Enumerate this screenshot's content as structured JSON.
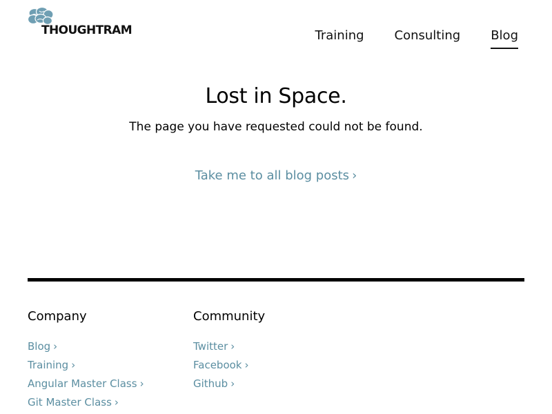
{
  "header": {
    "logo_text": "THOUGHTRAM",
    "nav": [
      {
        "label": "Training",
        "active": false
      },
      {
        "label": "Consulting",
        "active": false
      },
      {
        "label": "Blog",
        "active": true
      }
    ]
  },
  "main": {
    "title": "Lost in Space.",
    "subtitle": "The page you have requested could not be found.",
    "cta_label": "Take me to all blog posts"
  },
  "footer": {
    "company": {
      "heading": "Company",
      "links": [
        "Blog",
        "Training",
        "Angular Master Class",
        "Git Master Class"
      ]
    },
    "community": {
      "heading": "Community",
      "links": [
        "Twitter",
        "Facebook",
        "Github"
      ]
    }
  },
  "icons": {
    "logo": "brain-icon",
    "link_arrow": "chevron-right-icon"
  },
  "colors": {
    "link": "#5b8ea1",
    "text": "#000000",
    "logo_mark": "#6f9fb3",
    "divider": "#000000"
  }
}
